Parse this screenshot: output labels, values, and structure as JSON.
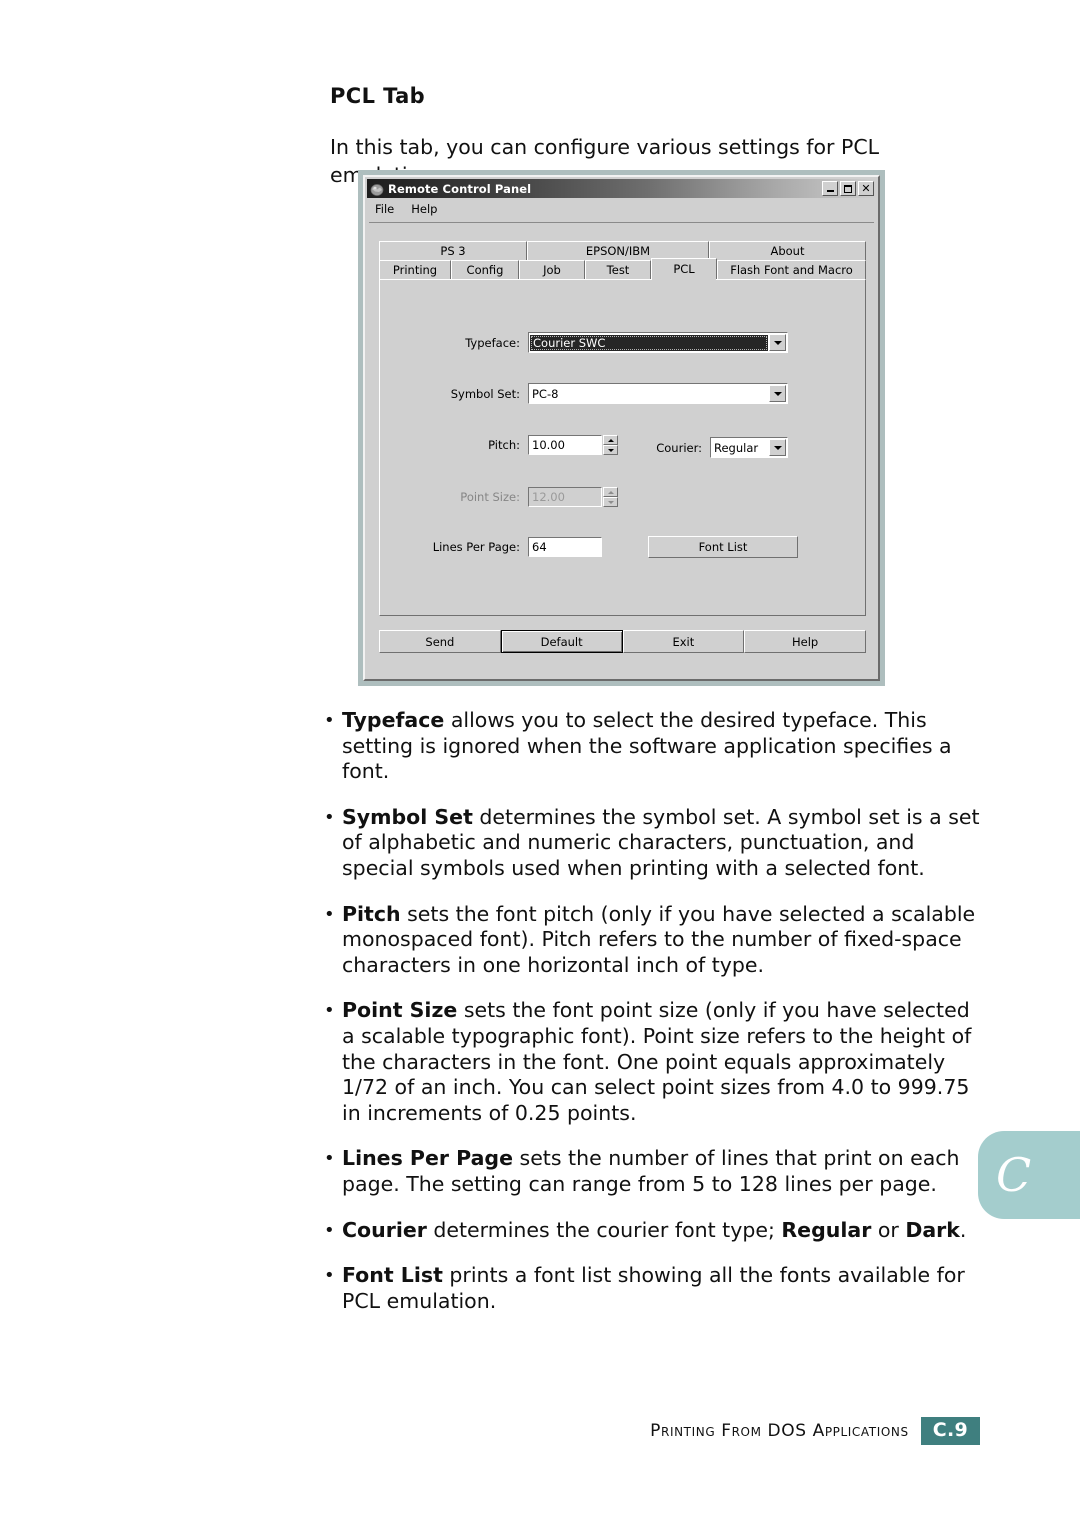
{
  "page": {
    "heading": "PCL Tab",
    "intro": "In this tab, you can configure various settings for PCL emulation.",
    "thumb_tab_letter": "C",
    "thumb_tab_color": "#a4cdcd",
    "footer_text": "Printing From DOS Applications",
    "footer_page": "C.9",
    "footer_badge_color": "#3f7f7f"
  },
  "dialog": {
    "title": "Remote Control Panel",
    "title_icon": "printer-globe-icon",
    "window_buttons": {
      "minimize": "minimize-icon",
      "maximize": "maximize-icon",
      "close": "close-icon"
    },
    "menu": [
      {
        "label": "File"
      },
      {
        "label": "Help"
      }
    ],
    "tabs_row1": [
      {
        "label": "PS 3",
        "active": false
      },
      {
        "label": "EPSON/IBM",
        "active": false
      },
      {
        "label": "About",
        "active": false
      }
    ],
    "tabs_row2": [
      {
        "label": "Printing",
        "active": false
      },
      {
        "label": "Config",
        "active": false
      },
      {
        "label": "Job",
        "active": false
      },
      {
        "label": "Test",
        "active": false
      },
      {
        "label": "PCL",
        "active": true
      },
      {
        "label": "Flash Font and Macro",
        "active": false
      }
    ],
    "fields": {
      "typeface": {
        "label": "Typeface:",
        "value": "Courier SWC",
        "selected": true,
        "enabled": true
      },
      "symbol_set": {
        "label": "Symbol Set:",
        "value": "PC-8",
        "enabled": true
      },
      "pitch": {
        "label": "Pitch:",
        "value": "10.00",
        "enabled": true
      },
      "courier": {
        "label": "Courier:",
        "value": "Regular",
        "enabled": true
      },
      "point_size": {
        "label": "Point Size:",
        "value": "12.00",
        "enabled": false
      },
      "lines_per_page": {
        "label": "Lines Per Page:",
        "value": "64",
        "enabled": true
      },
      "font_list_button": {
        "label": "Font List"
      }
    },
    "buttons": [
      {
        "label": "Send",
        "default": false
      },
      {
        "label": "Default",
        "default": true
      },
      {
        "label": "Exit",
        "default": false
      },
      {
        "label": "Help",
        "default": false
      }
    ]
  },
  "bullets": [
    {
      "term": "Typeface",
      "rest": " allows you to select the desired typeface. This setting is ignored when the software application specifies a font."
    },
    {
      "term": "Symbol Set",
      "rest": " determines the symbol set. A symbol set is a set of alphabetic and numeric characters, punctuation, and special symbols used when printing with a selected font."
    },
    {
      "term": "Pitch",
      "rest": " sets the font pitch (only if you have selected a scalable monospaced font). Pitch refers to the number of fixed-space characters in one horizontal inch of type."
    },
    {
      "term": "Point Size",
      "rest": " sets the font point size (only if you have selected a scalable typographic font). Point size refers to the height of the characters in the font. One point equals approximately 1/72 of an inch. You can select point sizes from 4.0 to 999.75 in increments of 0.25 points."
    },
    {
      "term": "Lines Per Page",
      "rest": " sets the number of lines that print on each page. The setting can range from 5 to 128 lines per page."
    },
    {
      "term": "Courier",
      "rest": " determines the courier font type; ",
      "term2": "Regular",
      "rest2": " or ",
      "term3": "Dark",
      "rest3": "."
    },
    {
      "term": "Font List",
      "rest": " prints a font list showing all the fonts available for PCL emulation."
    }
  ]
}
